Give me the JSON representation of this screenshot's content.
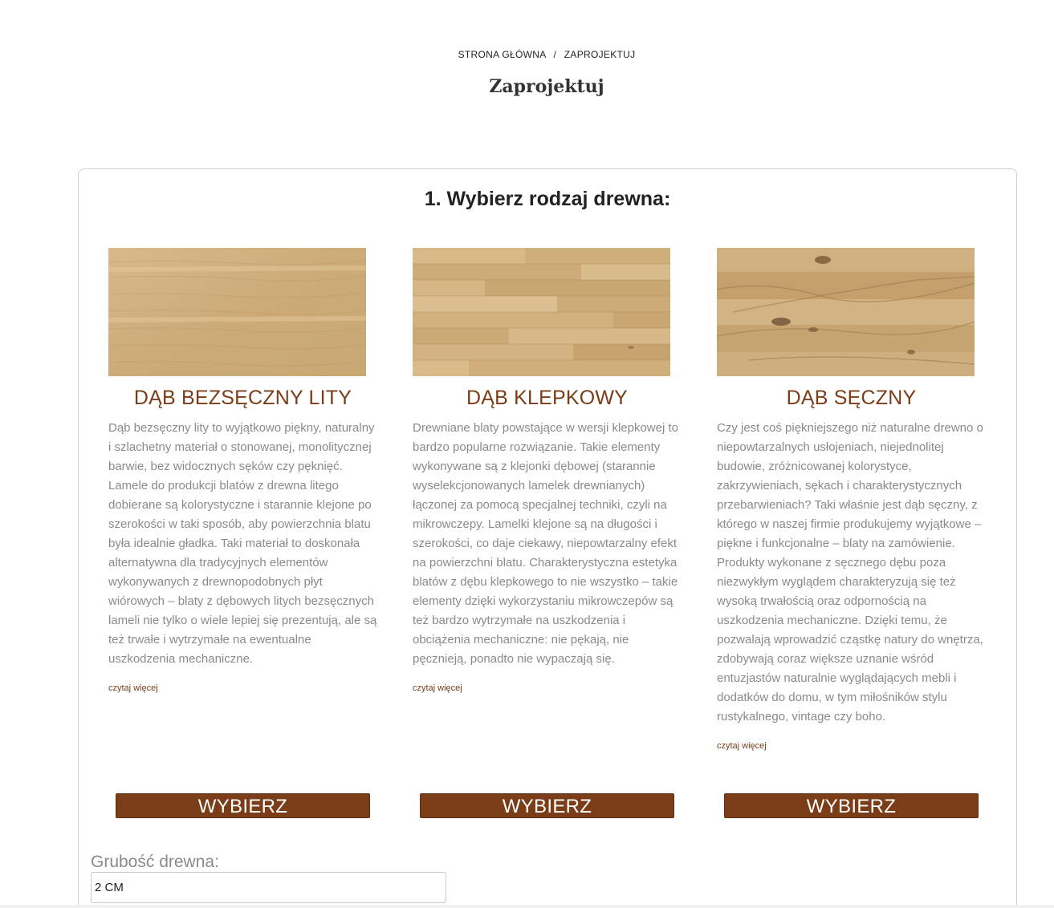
{
  "breadcrumb": {
    "home": "STRONA GŁÓWNA",
    "separator": "/",
    "current": "ZAPROJEKTUJ"
  },
  "page_title": "Zaprojektuj",
  "step": {
    "title": "1. Wybierz rodzaj drewna:"
  },
  "colors": {
    "accent": "#7a3d18",
    "text_muted": "#8a8a8a",
    "border": "#cfcfcf"
  },
  "options": [
    {
      "name": "DĄB BEZSĘCZNY LITY",
      "description": "Dąb bezsęczny lity to wyjątkowo piękny, naturalny i szlachetny materiał o stonowanej, monolitycznej barwie, bez widocznych sęków czy pęknięć. Lamele do produkcji blatów z drewna litego dobierane są kolorystyczne i starannie klejone po szerokości w taki sposób, aby powierzchnia blatu była idealnie gładka. Taki materiał to doskonała alternatywna dla tradycyjnych elementów wykonywanych z drewnopodobnych płyt wiórowych – blaty z dębowych litych bezsęcznych lameli nie tylko o wiele lepiej się prezentują, ale są też trwałe i wytrzymałe na ewentualne uszkodzenia mechaniczne.",
      "read_more": "czytaj więcej",
      "button": "WYBIERZ",
      "image_icon": "wood-texture-plain"
    },
    {
      "name": "DĄB KLEPKOWY",
      "description": "Drewniane blaty powstające w wersji klepkowej to bardzo popularne rozwiązanie. Takie elementy wykonywane są z klejonki dębowej (starannie wyselekcjonowanych lamelek drewnianych) łączonej za pomocą specjalnej techniki, czyli na mikrowczepy. Lamelki klejone są na długości i szerokości, co daje ciekawy, niepowtarzalny efekt na powierzchni blatu. Charakterystyczna estetyka blatów z dębu klepkowego to nie wszystko – takie elementy dzięki wykorzystaniu mikrowczepów są też bardzo wytrzymałe na uszkodzenia i obciążenia mechaniczne: nie pękają, nie pęcznieją, ponadto nie wypaczają się.",
      "read_more": "czytaj więcej",
      "button": "WYBIERZ",
      "image_icon": "wood-texture-staves"
    },
    {
      "name": "DĄB SĘCZNY",
      "description": "Czy jest coś piękniejszego niż naturalne drewno o niepowtarzalnych usłojeniach, niejednolitej budowie, zróżnicowanej kolorystyce, zakrzywieniach, sękach i charakterystycznych przebarwieniach? Taki właśnie jest dąb sęczny, z którego w naszej firmie produkujemy wyjątkowe – piękne i funkcjonalne – blaty na zamówienie. Produkty wykonane z sęcznego dębu poza niezwykłym wyglądem charakteryzują się też wysoką trwałością oraz odpornością na uszkodzenia mechaniczne. Dzięki temu, że pozwalają wprowadzić cząstkę natury do wnętrza, zdobywają coraz większe uznanie wśród entuzjastów naturalnie wyglądających mebli i dodatków do domu, w tym miłośników stylu rustykalnego, vintage czy boho.",
      "read_more": "czytaj więcej",
      "button": "WYBIERZ",
      "image_icon": "wood-texture-knotty"
    }
  ],
  "thickness": {
    "label": "Grubość drewna:",
    "selected": "2 CM"
  }
}
